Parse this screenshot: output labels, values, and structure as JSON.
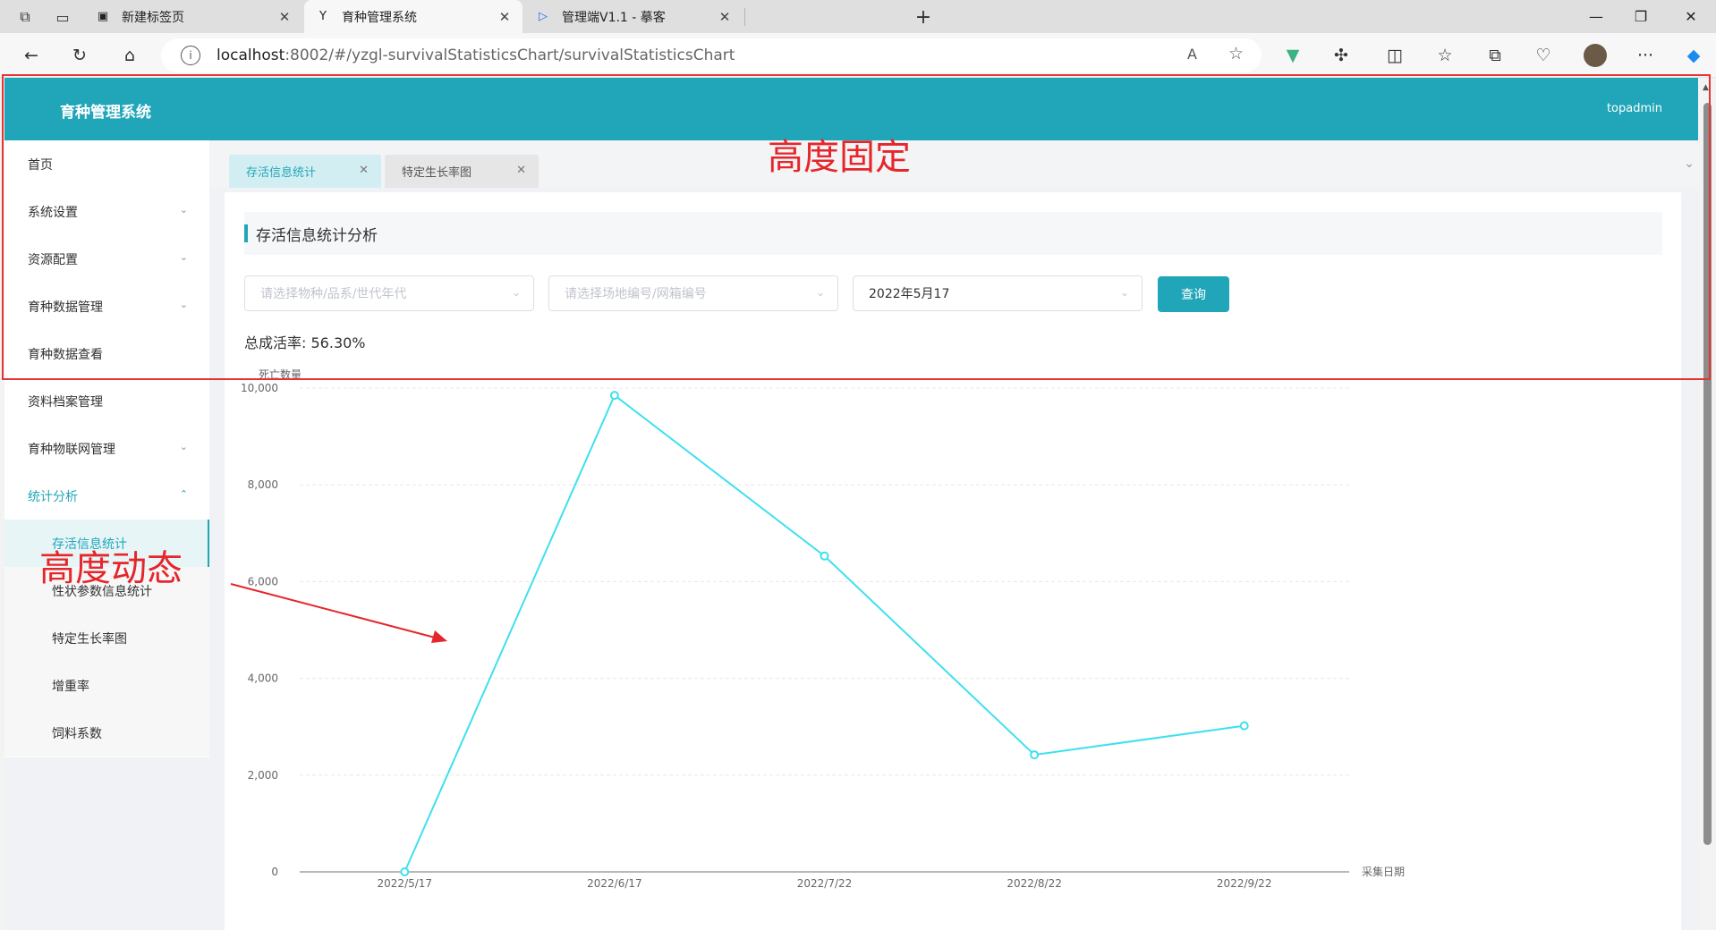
{
  "browser": {
    "tabs": [
      {
        "title": "新建标签页",
        "favicon": "new-tab-icon",
        "active": false
      },
      {
        "title": "育种管理系统",
        "favicon": "y-logo-icon",
        "active": true
      },
      {
        "title": "管理端V1.1 - 摹客",
        "favicon": "play-logo-icon",
        "active": false
      }
    ],
    "new_tab": "+",
    "url_host": "localhost",
    "url_rest": ":8002/#/yzgl-survivalStatisticsChart/survivalStatisticsChart"
  },
  "app": {
    "brand": "育种管理系统",
    "user": "topadmin",
    "accent_color": "#20a6b8"
  },
  "sidebar": {
    "items": [
      {
        "label": "首页",
        "has_arrow": false
      },
      {
        "label": "系统设置",
        "has_arrow": true
      },
      {
        "label": "资源配置",
        "has_arrow": true
      },
      {
        "label": "育种数据管理",
        "has_arrow": true
      },
      {
        "label": "育种数据查看",
        "has_arrow": false
      },
      {
        "label": "资料档案管理",
        "has_arrow": false
      },
      {
        "label": "育种物联网管理",
        "has_arrow": true
      },
      {
        "label": "统计分析",
        "has_arrow": true,
        "open": true
      }
    ],
    "submenu": [
      {
        "label": "存活信息统计",
        "active": true
      },
      {
        "label": "性状参数信息统计",
        "active": false
      },
      {
        "label": "特定生长率图",
        "active": false
      },
      {
        "label": "增重率",
        "active": false
      },
      {
        "label": "饲料系数",
        "active": false
      }
    ]
  },
  "view_tabs": [
    {
      "label": "存活信息统计",
      "active": true
    },
    {
      "label": "特定生长率图",
      "active": false
    }
  ],
  "page": {
    "section_title": "存活信息统计分析",
    "filters": {
      "species_placeholder": "请选择物种/品系/世代年代",
      "site_placeholder": "请选择场地编号/网箱编号",
      "date_value": "2022年5月17"
    },
    "query_label": "查询",
    "survival_rate_label": "总成活率:",
    "survival_rate_value": "56.30%"
  },
  "chart_data": {
    "type": "line",
    "ylabel": "死亡数量",
    "xlabel": "采集日期",
    "categories": [
      "2022/5/17",
      "2022/6/17",
      "2022/7/22",
      "2022/8/22",
      "2022/9/22"
    ],
    "values": [
      0,
      9850,
      6530,
      2420,
      3020
    ],
    "ylim": [
      0,
      10000
    ],
    "yticks": [
      "0",
      "2,000",
      "4,000",
      "6,000",
      "8,000",
      "10,000"
    ],
    "line_color": "#3ee0ef",
    "grid": true
  },
  "annotations": {
    "fixed": "高度固定",
    "dynamic": "高度动态",
    "color": "#e5262b"
  }
}
